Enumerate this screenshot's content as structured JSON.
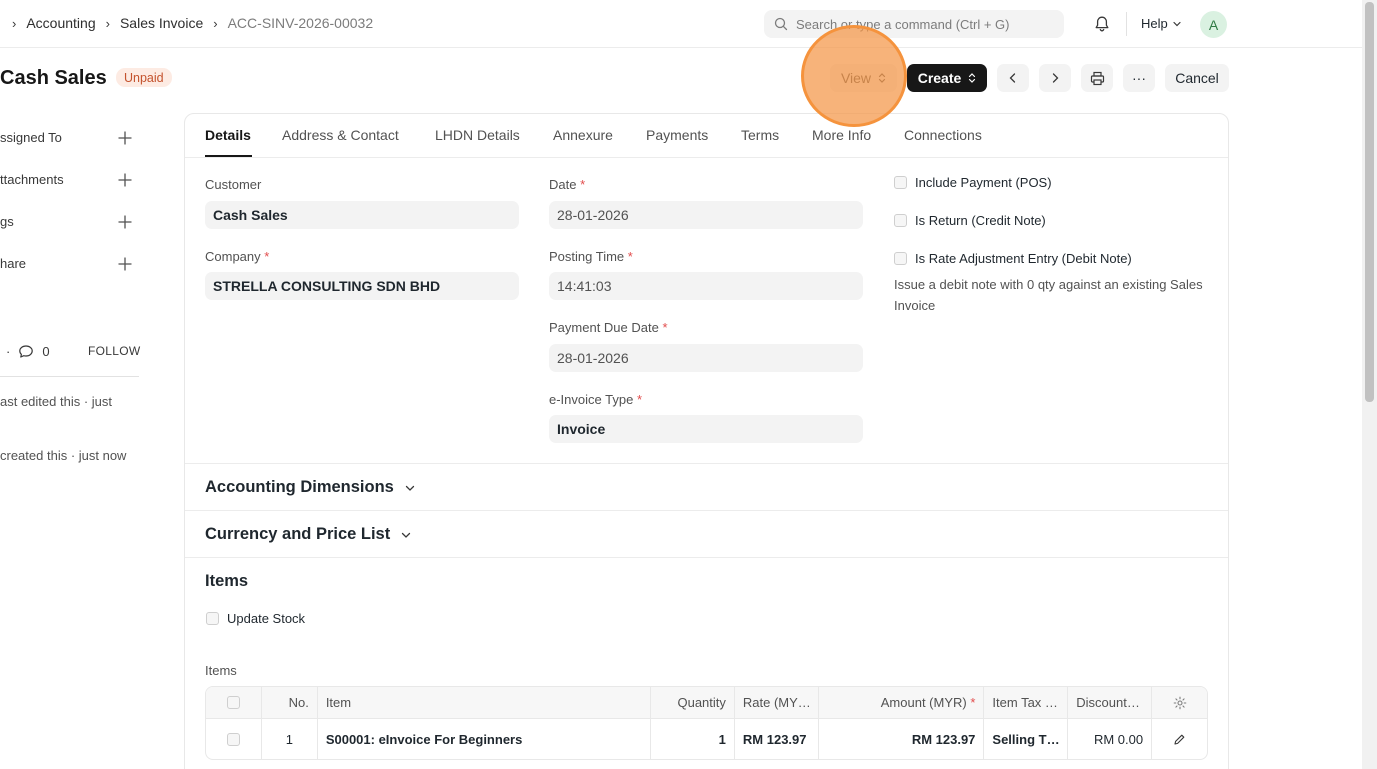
{
  "breadcrumb": {
    "items": [
      "Accounting",
      "Sales Invoice"
    ],
    "current": "ACC-SINV-2026-00032"
  },
  "navbar": {
    "search_placeholder": "Search or type a command (Ctrl + G)",
    "help_label": "Help",
    "avatar_initial": "A"
  },
  "page": {
    "title": "Cash Sales",
    "status": "Unpaid"
  },
  "actions": {
    "view_label": "View",
    "create_label": "Create",
    "more_label": "···",
    "cancel_label": "Cancel"
  },
  "sidebar": {
    "assigned_to": "ssigned To",
    "attachments": "ttachments",
    "tags": "gs",
    "share": "hare",
    "like_separator": "·",
    "comment_count": "0",
    "follow": "FOLLOW",
    "activity_1": "ast edited this · just",
    "activity_2": "created this · just now"
  },
  "tabs": [
    "Details",
    "Address & Contact",
    "LHDN Details",
    "Annexure",
    "Payments",
    "Terms",
    "More Info",
    "Connections"
  ],
  "details": {
    "customer_label": "Customer",
    "customer_value": "Cash Sales",
    "company_label": "Company",
    "company_value": "STRELLA CONSULTING SDN BHD",
    "date_label": "Date",
    "date_value": "28-01-2026",
    "posting_time_label": "Posting Time",
    "posting_time_value": "14:41:03",
    "due_date_label": "Payment Due Date",
    "due_date_value": "28-01-2026",
    "einvoice_type_label": "e-Invoice Type",
    "einvoice_type_value": "Invoice",
    "required_mark": "*",
    "include_payment_label": "Include Payment (POS)",
    "is_return_label": "Is Return (Credit Note)",
    "rate_adjustment_label": "Is Rate Adjustment Entry (Debit Note)",
    "rate_adjustment_help": "Issue a debit note with 0 qty against an existing Sales Invoice"
  },
  "sections": {
    "accounting_dimensions": "Accounting Dimensions",
    "currency_price_list": "Currency and Price List",
    "items": "Items",
    "update_stock_label": "Update Stock",
    "items_table_label": "Items"
  },
  "items_table": {
    "columns": [
      "No.",
      "Item",
      "Quantity",
      "Rate (MY…",
      "Amount (MYR)",
      "Item Tax …",
      "Discount…"
    ],
    "rows": [
      {
        "no": "1",
        "item": "S00001: eInvoice For Beginners",
        "quantity": "1",
        "rate": "RM 123.97",
        "amount": "RM 123.97",
        "item_tax": "Selling T…",
        "discount": "RM 0.00"
      }
    ]
  },
  "colors": {
    "status_bg": "#fdebe3",
    "status_text": "#c4522d",
    "primary_button": "#171717",
    "click_highlight": "#f5933d",
    "avatar_bg": "#daf1e1"
  }
}
